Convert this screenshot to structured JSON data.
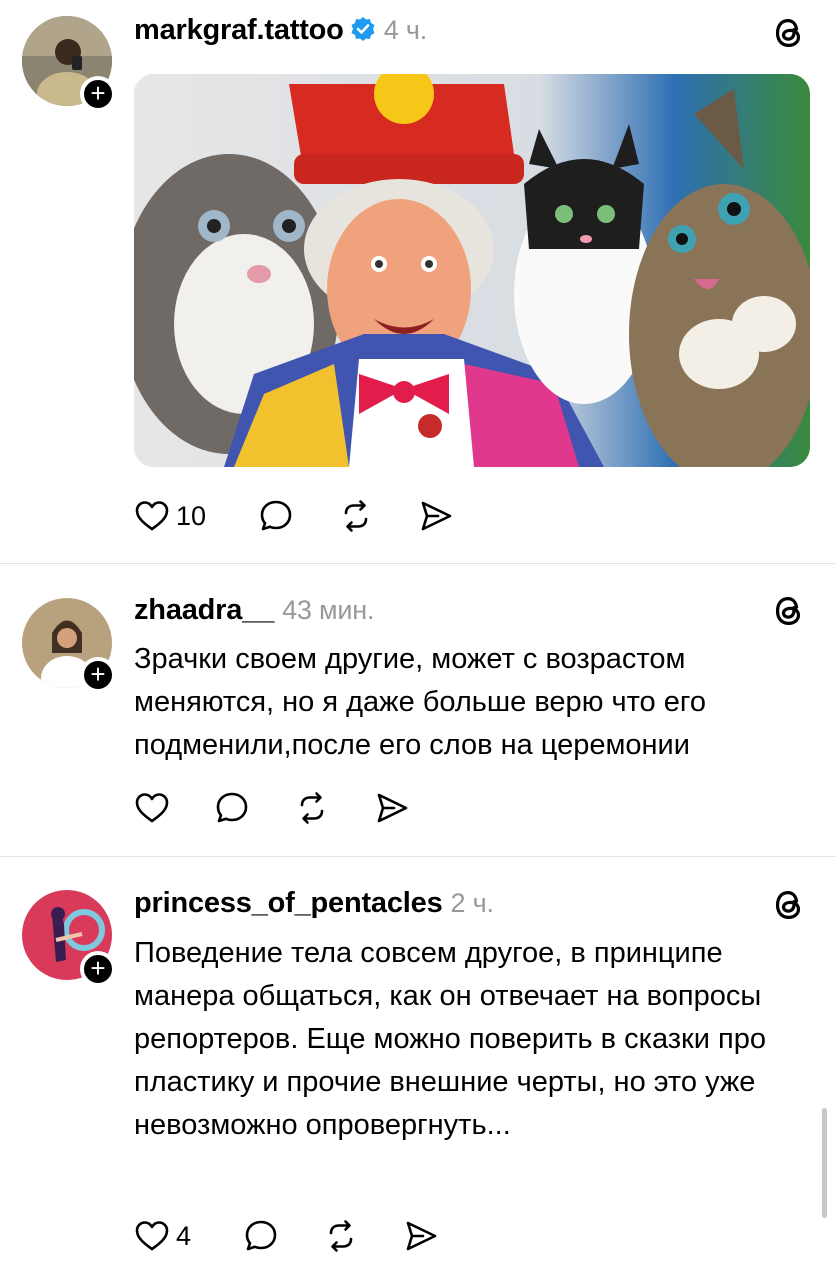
{
  "posts": [
    {
      "username": "markgraf.tattoo",
      "verified": true,
      "time": "4 ч.",
      "text": "",
      "likes": "10",
      "has_image": true,
      "image_description": "clown-with-cats-photo"
    },
    {
      "username": "zhaadra__",
      "verified": false,
      "time": "43 мин.",
      "text": "Зрачки своем другие, может с возрастом меняются, но я даже больше верю что его подменили,после его слов на церемонии",
      "likes": ""
    },
    {
      "username": "princess_of_pentacles",
      "verified": false,
      "time": "2 ч.",
      "text": "Поведение тела совсем другое, в принципе манера общаться, как он отвечает на вопросы репортеров. Еще можно поверить в сказки про пластику и прочие внешние черты, но это уже невозможно опровергнуть...",
      "likes": "4"
    }
  ],
  "follow_symbol": "+",
  "colors": {
    "verified_blue": "#1d9bf0",
    "time_gray": "#999999",
    "divider": "#e3e3e3"
  },
  "icons": [
    "threads-icon",
    "heart-icon",
    "comment-icon",
    "repost-icon",
    "share-icon",
    "verified-icon"
  ]
}
